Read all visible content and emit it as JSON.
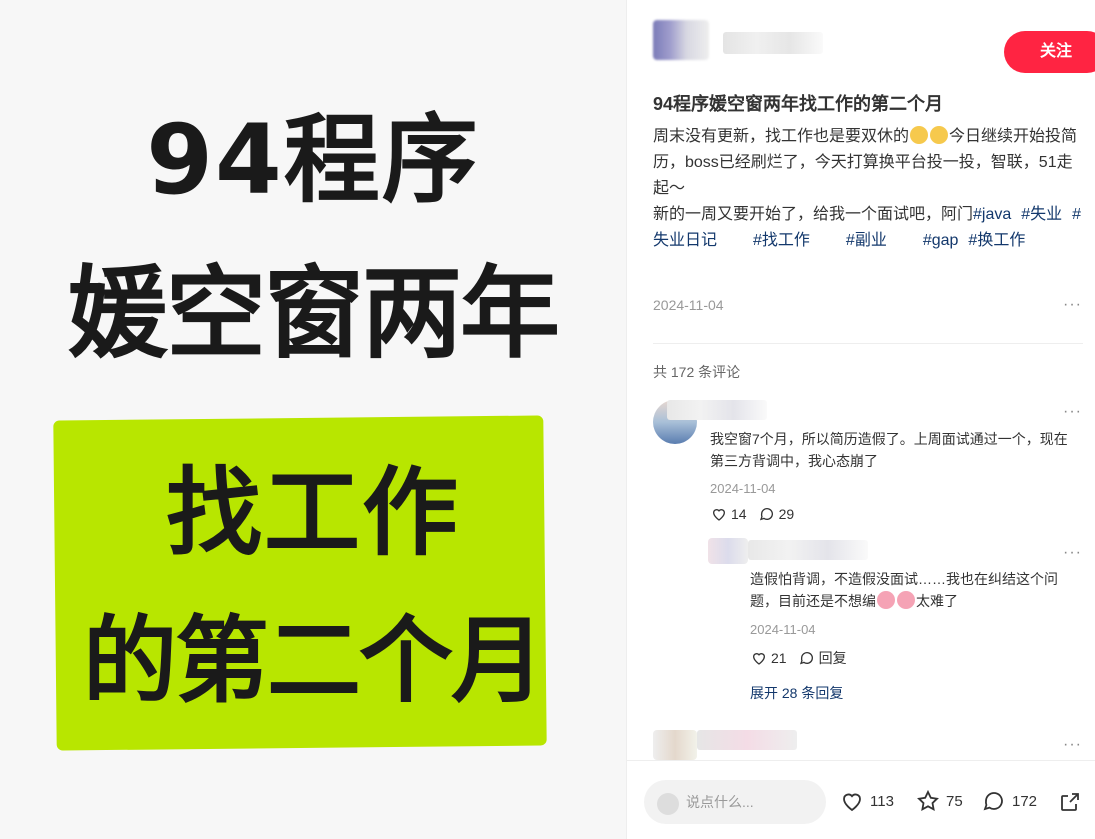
{
  "image": {
    "line1": "94程序",
    "line2": "媛空窗两年",
    "line3": "找工作",
    "line4": "的第二个月",
    "highlight_color": "#b8e600"
  },
  "author": {
    "follow_label": "关注"
  },
  "post": {
    "title": "94程序媛空窗两年找工作的第二个月",
    "body_part1": "周末没有更新，找工作也是要双休的",
    "body_part2": "今日继续开始投简历，boss已经刷烂了，今天打算换平台投一投，智联，51走起～",
    "body_part3": "新的一周又要开始了，给我一个面试吧，阿门",
    "tags": [
      "#java",
      "#失业",
      "#失业日记",
      "#找工作",
      "#副业",
      "#gap",
      "#换工作"
    ],
    "date": "2024-11-04"
  },
  "comments": {
    "count_label": "共 172 条评论",
    "items": [
      {
        "text": "我空窗7个月，所以简历造假了。上周面试通过一个，现在第三方背调中，我心态崩了",
        "date": "2024-11-04",
        "likes": "14",
        "replies": "29"
      }
    ],
    "reply": {
      "text_part1": "造假怕背调，不造假没面试……我也在纠结这个问题，目前还是不想编",
      "text_part2": "太难了",
      "date": "2024-11-04",
      "likes": "21",
      "reply_label": "回复"
    },
    "expand_label": "展开 28 条回复"
  },
  "bottom_bar": {
    "input_placeholder": "说点什么...",
    "like_count": "113",
    "collect_count": "75",
    "comment_count": "172"
  },
  "colors": {
    "accent": "#ff2442",
    "tag": "#13386c"
  }
}
